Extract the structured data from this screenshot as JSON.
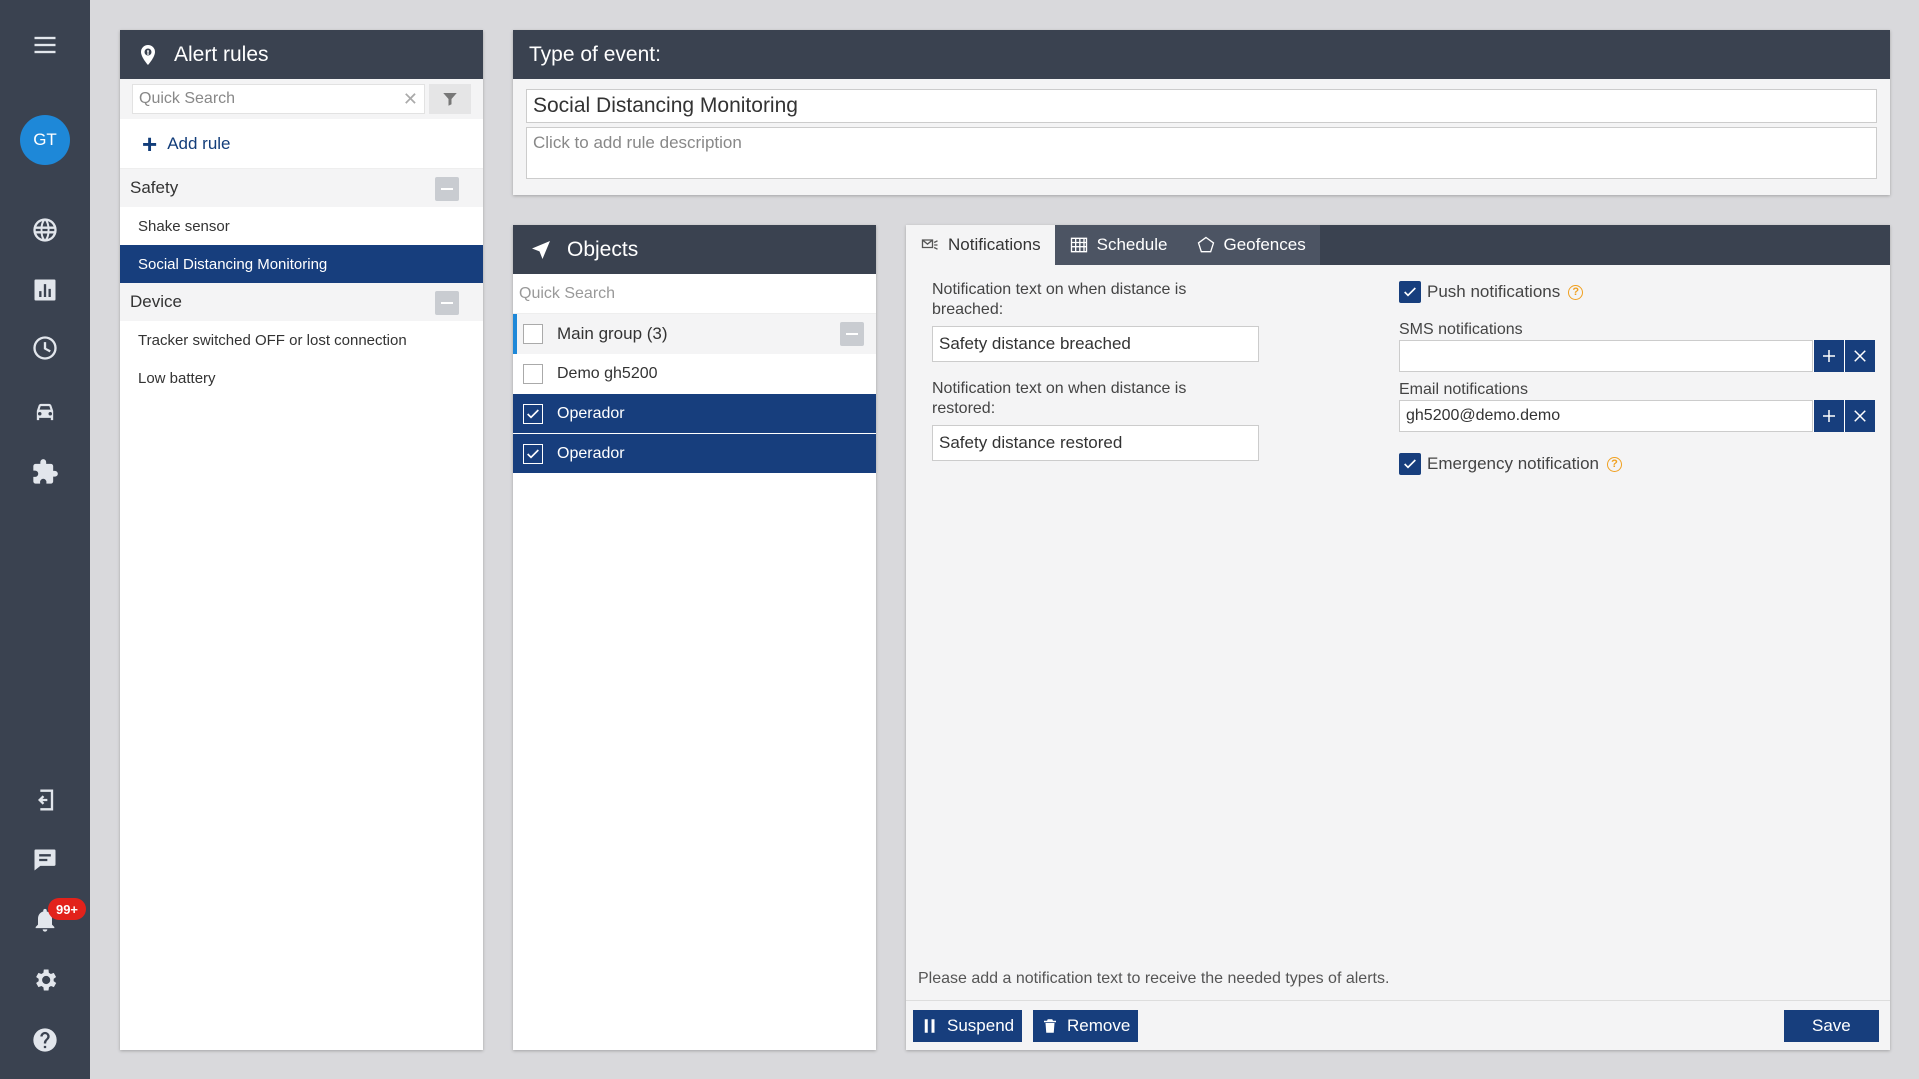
{
  "rail": {
    "avatar_initials": "GT",
    "notification_badge": "99+",
    "icons": [
      "menu-icon",
      "globe-icon",
      "bar-chart-icon",
      "history-icon",
      "car-icon",
      "puzzle-icon",
      "logout-icon",
      "chat-icon",
      "bell-icon",
      "gear-icon",
      "help-icon"
    ]
  },
  "rules_panel": {
    "title": "Alert rules",
    "search_placeholder": "Quick Search",
    "add_rule": "Add rule",
    "groups": [
      {
        "name": "Safety",
        "items": [
          "Shake sensor",
          "Social Distancing Monitoring"
        ]
      },
      {
        "name": "Device",
        "items": [
          "Tracker switched OFF or lost connection",
          "Low battery"
        ]
      }
    ],
    "selected_item": "Social Distancing Monitoring"
  },
  "event_panel": {
    "title": "Type of event:",
    "name_value": "Social Distancing Monitoring",
    "description_placeholder": "Click to add rule description"
  },
  "objects_panel": {
    "title": "Objects",
    "search_placeholder": "Quick Search",
    "group_label": "Main group (3)",
    "rows": [
      {
        "label": "Demo gh5200",
        "checked": false
      },
      {
        "label": "Operador",
        "checked": true
      },
      {
        "label": "Operador",
        "checked": true
      }
    ]
  },
  "notifications_panel": {
    "tabs": [
      "Notifications",
      "Schedule",
      "Geofences"
    ],
    "active_tab": "Notifications",
    "breached_label": "Notification text on when distance is breached:",
    "breached_value": "Safety distance breached",
    "restored_label": "Notification text on when distance is restored:",
    "restored_value": "Safety distance restored",
    "push_label": "Push notifications",
    "push_checked": true,
    "sms_label": "SMS notifications",
    "sms_value": "",
    "email_label": "Email notifications",
    "email_value": "gh5200@demo.demo",
    "emergency_label": "Emergency notification",
    "emergency_checked": true,
    "hint": "Please add a notification text to receive the needed types of alerts.",
    "suspend_label": "Suspend",
    "remove_label": "Remove",
    "save_label": "Save"
  },
  "colors": {
    "header_dark": "#3a4250",
    "selected_blue": "#173e7d",
    "accent_blue": "#1e88d8",
    "badge_red": "#e2221b",
    "help_orange": "#f0a020"
  }
}
